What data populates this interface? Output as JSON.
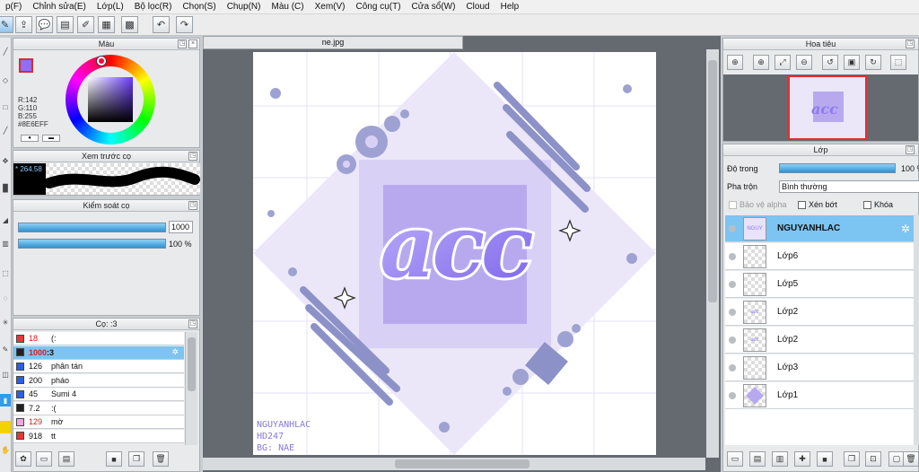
{
  "menu": [
    "p(F)",
    "Chỉnh sửa(E)",
    "Lớp(L)",
    "Bộ lọc(R)",
    "Chọn(S)",
    "Chụp(N)",
    "Màu (C)",
    "Xem(V)",
    "Công cụ(T)",
    "Cửa sổ(W)",
    "Cloud",
    "Help"
  ],
  "color_panel": {
    "title": "Màu",
    "r": "R:142",
    "g": "G:110",
    "b": "B:255",
    "hex": "#8E6EFF",
    "accent": "#8E6EFF"
  },
  "preview_panel": {
    "title": "Xem trước cọ",
    "size": "264.58"
  },
  "brush_control": {
    "title": "Kiểm soát cọ",
    "size": "1000",
    "opacity": "100 %",
    "opacity_value": 100
  },
  "brush_list": {
    "title": "Cọ: :3",
    "items": [
      {
        "size": "18",
        "name": "(:",
        "color": "#e53935",
        "red": true
      },
      {
        "size": "1000",
        "name": ":3",
        "color": "#222222",
        "red": true,
        "selected": true
      },
      {
        "size": "126",
        "name": "phân tán",
        "color": "#2f5fe0"
      },
      {
        "size": "200",
        "name": "pháo",
        "color": "#2f5fe0"
      },
      {
        "size": "45",
        "name": "Sumi 4",
        "color": "#2f5fe0"
      },
      {
        "size": "7.2",
        "name": ":(",
        "color": "#222222"
      },
      {
        "size": "129",
        "name": "mờ",
        "color": "#f4a7e0",
        "red": true
      },
      {
        "size": "918",
        "name": "tt",
        "color": "#e53935"
      }
    ]
  },
  "document": {
    "tab": "ne.jpg"
  },
  "artwork": {
    "title": "acc",
    "credit": [
      "NGUYANHLAC",
      "HD247",
      "BG: NAE"
    ],
    "colors": {
      "bg": "#ffffff",
      "diamond": "#ebe7f9",
      "square_outer": "#d9d1f5",
      "square_inner": "#b8a9ef",
      "text": "#8e7af0",
      "accent": "#8c92c8"
    }
  },
  "navigator": {
    "title": "Hoa tiêu"
  },
  "layers": {
    "title": "Lớp",
    "opacity_label": "Độ trong",
    "opacity": "100 %",
    "blend_label": "Pha trộn",
    "blend": "Bình thường",
    "protect": "Bảo vệ alpha",
    "clip": "Xén bớt",
    "lock": "Khóa",
    "items": [
      {
        "name": "NGUYANHLAC",
        "selected": true,
        "thumb": "text"
      },
      {
        "name": "Lớp6",
        "thumb": "empty"
      },
      {
        "name": "Lớp5",
        "thumb": "empty"
      },
      {
        "name": "Lớp2",
        "thumb": "mini"
      },
      {
        "name": "Lớp2",
        "thumb": "mini"
      },
      {
        "name": "Lớp3",
        "thumb": "empty"
      },
      {
        "name": "Lớp1",
        "thumb": "diamond"
      }
    ]
  }
}
